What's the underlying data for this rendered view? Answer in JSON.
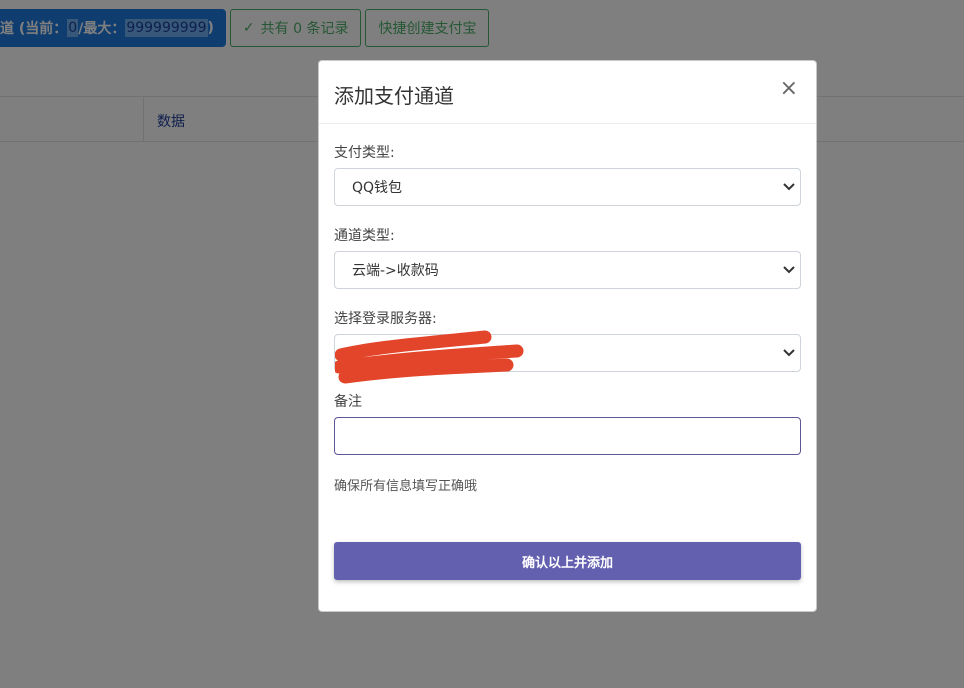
{
  "background": {
    "quota": {
      "prefix": "道 (当前：",
      "current": "0",
      "sep": "/最大：",
      "max": "999999999",
      "suffix": ")"
    },
    "records_label": "共有 0 条记录",
    "create_alipay_label": "快捷创建支付宝",
    "table": {
      "column_data": "数据"
    }
  },
  "modal": {
    "title": "添加支付通道",
    "close_symbol": "×",
    "pay_type_label": "支付类型:",
    "pay_type_value": "QQ钱包",
    "channel_type_label": "通道类型:",
    "channel_type_value": "云端->收款码",
    "server_label": "选择登录服务器:",
    "server_value": "",
    "note_label": "备注",
    "note_value": "",
    "hint": "确保所有信息填写正确哦",
    "submit_label": "确认以上并添加"
  },
  "colors": {
    "primary": "#1f7ae0",
    "success": "#4caf6a",
    "submit": "#6460b0",
    "redaction": "#e3452a"
  },
  "icons": {
    "check": "check-icon",
    "close": "close-icon",
    "dropdown": "chevron-down-icon"
  }
}
